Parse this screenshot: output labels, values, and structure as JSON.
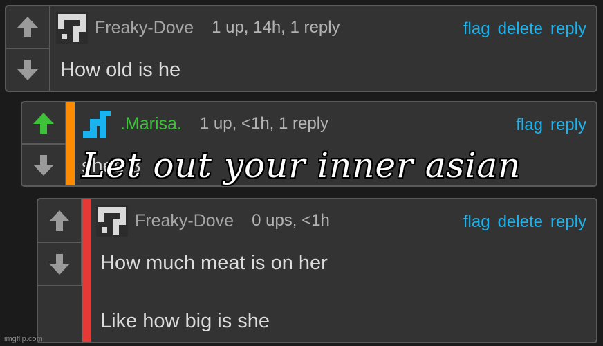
{
  "comments": [
    {
      "username": "Freaky-Dove",
      "meta": "1 up, 14h, 1 reply",
      "actions": [
        "flag",
        "delete",
        "reply"
      ],
      "lines": [
        "How old is he"
      ],
      "upvoted": false,
      "username_color": "#a6a6a6",
      "stripe_color": null
    },
    {
      "username": ".Marisa.",
      "meta": "1 up, <1h, 1 reply",
      "actions": [
        "flag",
        "reply"
      ],
      "lines": [
        "shes 3"
      ],
      "upvoted": true,
      "username_color": "#3ec23a",
      "stripe_color": "#ff8c00"
    },
    {
      "username": "Freaky-Dove",
      "meta": "0 ups, <1h",
      "actions": [
        "flag",
        "delete",
        "reply"
      ],
      "lines": [
        "How much meat is on her",
        "Like how big is she"
      ],
      "upvoted": false,
      "username_color": "#a6a6a6",
      "stripe_color": "#e53935"
    }
  ],
  "overlay_caption": "Let out your inner asian",
  "watermark": "imgflip.com",
  "colors": {
    "link": "#19b4f0",
    "upvote_active": "#3ec23a",
    "arrow_inactive": "#9a9a9a"
  },
  "icons": {
    "upvote": "arrow-up-icon",
    "downvote": "arrow-down-icon"
  }
}
